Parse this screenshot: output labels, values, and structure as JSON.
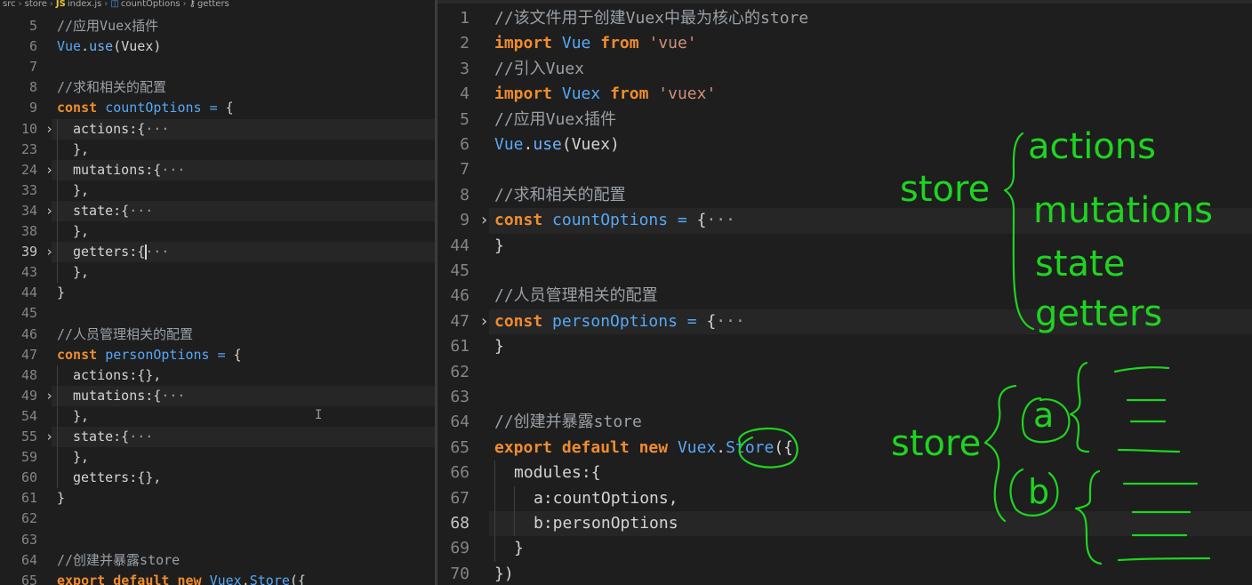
{
  "left_breadcrumb": {
    "items": [
      "src",
      "store",
      "index.js",
      "countOptions",
      "getters"
    ]
  },
  "left_lines": [
    {
      "num": "5",
      "text": "//应用Vuex插件",
      "kind": "comment"
    },
    {
      "num": "6",
      "text": "Vue.use(Vuex)",
      "kind": "use"
    },
    {
      "num": "7",
      "text": "",
      "kind": "blank"
    },
    {
      "num": "8",
      "text": "//求和相关的配置",
      "kind": "comment"
    },
    {
      "num": "9",
      "text": "const countOptions = {",
      "kind": "const",
      "name": "countOptions"
    },
    {
      "num": "10",
      "text": "actions:{",
      "kind": "folded",
      "indent": 1
    },
    {
      "num": "23",
      "text": "},",
      "kind": "plain",
      "indent": 1
    },
    {
      "num": "24",
      "text": "mutations:{",
      "kind": "folded",
      "indent": 1
    },
    {
      "num": "33",
      "text": "},",
      "kind": "plain",
      "indent": 1
    },
    {
      "num": "34",
      "text": "state:{",
      "kind": "folded",
      "indent": 1
    },
    {
      "num": "38",
      "text": "},",
      "kind": "plain",
      "indent": 1
    },
    {
      "num": "39",
      "text": "getters:{",
      "kind": "folded",
      "indent": 1,
      "active": true
    },
    {
      "num": "43",
      "text": "},",
      "kind": "plain",
      "indent": 1
    },
    {
      "num": "44",
      "text": "}",
      "kind": "plain"
    },
    {
      "num": "45",
      "text": "",
      "kind": "blank"
    },
    {
      "num": "46",
      "text": "//人员管理相关的配置",
      "kind": "comment"
    },
    {
      "num": "47",
      "text": "const personOptions = {",
      "kind": "const",
      "name": "personOptions"
    },
    {
      "num": "48",
      "text": "actions:{},",
      "kind": "plain",
      "indent": 1
    },
    {
      "num": "49",
      "text": "mutations:{",
      "kind": "folded",
      "indent": 1
    },
    {
      "num": "54",
      "text": "},",
      "kind": "plain",
      "indent": 1
    },
    {
      "num": "55",
      "text": "state:{",
      "kind": "folded",
      "indent": 1
    },
    {
      "num": "59",
      "text": "},",
      "kind": "plain",
      "indent": 1
    },
    {
      "num": "60",
      "text": "getters:{},",
      "kind": "plain",
      "indent": 1
    },
    {
      "num": "61",
      "text": "}",
      "kind": "plain"
    },
    {
      "num": "62",
      "text": "",
      "kind": "blank"
    },
    {
      "num": "63",
      "text": "",
      "kind": "blank"
    },
    {
      "num": "64",
      "text": "//创建并暴露store",
      "kind": "comment"
    },
    {
      "num": "65",
      "text": "export default new Vuex.Store({",
      "kind": "export"
    }
  ],
  "right_lines": [
    {
      "num": "1",
      "text": "//该文件用于创建Vuex中最为核心的store",
      "kind": "comment"
    },
    {
      "num": "2",
      "text": "import Vue from 'vue'",
      "kind": "import",
      "name": "Vue",
      "module": "'vue'"
    },
    {
      "num": "3",
      "text": "//引入Vuex",
      "kind": "comment"
    },
    {
      "num": "4",
      "text": "import Vuex from 'vuex'",
      "kind": "import",
      "name": "Vuex",
      "module": "'vuex'"
    },
    {
      "num": "5",
      "text": "//应用Vuex插件",
      "kind": "comment"
    },
    {
      "num": "6",
      "text": "Vue.use(Vuex)",
      "kind": "use"
    },
    {
      "num": "7",
      "text": "",
      "kind": "blank"
    },
    {
      "num": "8",
      "text": "//求和相关的配置",
      "kind": "comment"
    },
    {
      "num": "9",
      "text": "const countOptions = {",
      "kind": "const",
      "name": "countOptions",
      "folded": true
    },
    {
      "num": "44",
      "text": "}",
      "kind": "plain"
    },
    {
      "num": "45",
      "text": "",
      "kind": "blank"
    },
    {
      "num": "46",
      "text": "//人员管理相关的配置",
      "kind": "comment"
    },
    {
      "num": "47",
      "text": "const personOptions = {",
      "kind": "const",
      "name": "personOptions",
      "folded": true
    },
    {
      "num": "61",
      "text": "}",
      "kind": "plain"
    },
    {
      "num": "62",
      "text": "",
      "kind": "blank"
    },
    {
      "num": "63",
      "text": "",
      "kind": "blank"
    },
    {
      "num": "64",
      "text": "//创建并暴露store",
      "kind": "comment"
    },
    {
      "num": "65",
      "text": "export default new Vuex.Store({",
      "kind": "export"
    },
    {
      "num": "66",
      "text": "modules:{",
      "kind": "plain",
      "indent": 1
    },
    {
      "num": "67",
      "text": "a:countOptions,",
      "kind": "plain",
      "indent": 2
    },
    {
      "num": "68",
      "text": "b:personOptions",
      "kind": "plain",
      "indent": 2,
      "active": true
    },
    {
      "num": "69",
      "text": "}",
      "kind": "plain",
      "indent": 1
    },
    {
      "num": "70",
      "text": "})",
      "kind": "plain"
    }
  ],
  "ellipsis": "···",
  "annotations": {
    "store_top": "store",
    "actions": "actions",
    "mutations": "mutations",
    "state": "state",
    "getters": "getters",
    "store_bottom": "store",
    "a": "a",
    "b": "b"
  },
  "colors": {
    "editor_bg": "#1e1e1e",
    "keyword": "#f08c2e",
    "identifier": "#56a8f5",
    "comment": "#9aa0a6",
    "string": "#ce9178",
    "annotation_green": "#1fd420"
  }
}
